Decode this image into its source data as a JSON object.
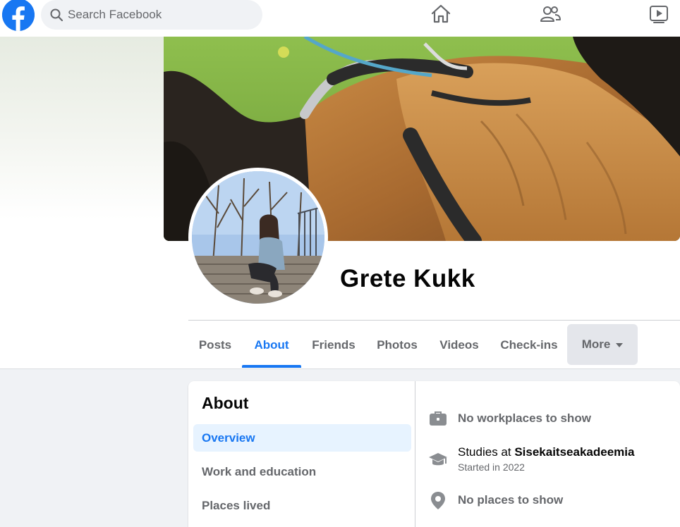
{
  "topbar": {
    "logo": "facebook-logo",
    "search_placeholder": "Search Facebook",
    "nav_icons": [
      "home-icon",
      "friends-icon",
      "watch-icon"
    ]
  },
  "colors": {
    "accent": "#1877f2",
    "muted_text": "#65676b",
    "page_background": "#f0f2f5"
  },
  "profile": {
    "name": "Grete Kukk"
  },
  "tabs": {
    "items": [
      "Posts",
      "About",
      "Friends",
      "Photos",
      "Videos",
      "Check-ins"
    ],
    "active": "About",
    "more_label": "More"
  },
  "about": {
    "heading": "About",
    "nav": [
      "Overview",
      "Work and education",
      "Places lived"
    ],
    "active_nav": "Overview",
    "work_text": "No workplaces to show",
    "studies_prefix": "Studies at ",
    "studies_school": "Sisekaitseakadeemia",
    "studies_sub": "Started in 2022",
    "places_text": "No places to show"
  }
}
